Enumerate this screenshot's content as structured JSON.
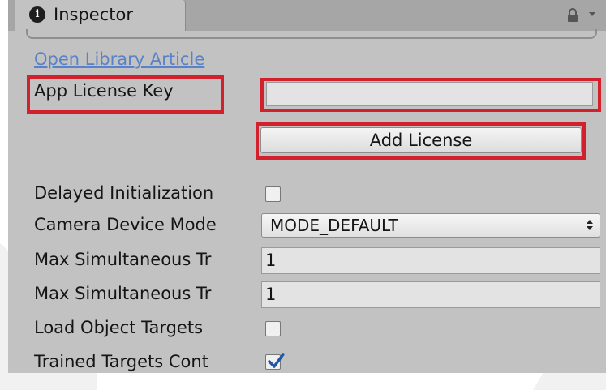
{
  "tab": {
    "title": "Inspector",
    "info_glyph": "i"
  },
  "header_icons": [
    "info-icon",
    "lock-icon",
    "menu-caret-icon"
  ],
  "link": {
    "label": "Open Library Article"
  },
  "license": {
    "label": "App License Key",
    "value": "",
    "add_button_label": "Add License"
  },
  "fields": {
    "delayed_initialization": {
      "label": "Delayed Initialization",
      "checked": false
    },
    "camera_device_mode": {
      "label": "Camera Device Mode",
      "value": "MODE_DEFAULT"
    },
    "max_simultaneous_1": {
      "label": "Max Simultaneous Tr",
      "value": "1"
    },
    "max_simultaneous_2": {
      "label": "Max Simultaneous Tr",
      "value": "1"
    },
    "load_object_targets": {
      "label": "Load Object Targets",
      "checked": false
    },
    "trained_targets": {
      "label": "Trained Targets Cont",
      "checked": true
    }
  },
  "highlight_color": "#d2202d",
  "link_color": "#5a82c9"
}
